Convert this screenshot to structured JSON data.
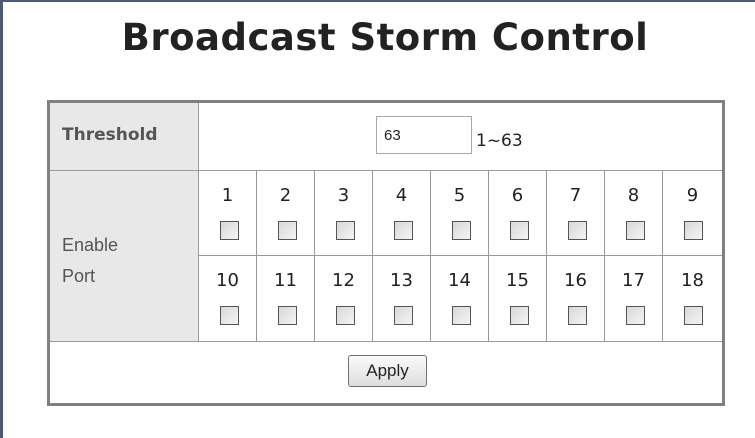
{
  "title": "Broadcast Storm Control",
  "threshold": {
    "label": "Threshold",
    "value": "63",
    "range": "1~63"
  },
  "enable_port": {
    "label_line1": "Enable",
    "label_line2": "Port",
    "ports": [
      {
        "number": "1",
        "checked": false
      },
      {
        "number": "2",
        "checked": false
      },
      {
        "number": "3",
        "checked": false
      },
      {
        "number": "4",
        "checked": false
      },
      {
        "number": "5",
        "checked": false
      },
      {
        "number": "6",
        "checked": false
      },
      {
        "number": "7",
        "checked": false
      },
      {
        "number": "8",
        "checked": false
      },
      {
        "number": "9",
        "checked": false
      },
      {
        "number": "10",
        "checked": false
      },
      {
        "number": "11",
        "checked": false
      },
      {
        "number": "12",
        "checked": false
      },
      {
        "number": "13",
        "checked": false
      },
      {
        "number": "14",
        "checked": false
      },
      {
        "number": "15",
        "checked": false
      },
      {
        "number": "16",
        "checked": false
      },
      {
        "number": "17",
        "checked": false
      },
      {
        "number": "18",
        "checked": false
      }
    ]
  },
  "apply_label": "Apply",
  "colors": {
    "frame_accent": "#4a5a78",
    "label_background": "#e8e8e8",
    "table_border": "#808080"
  }
}
